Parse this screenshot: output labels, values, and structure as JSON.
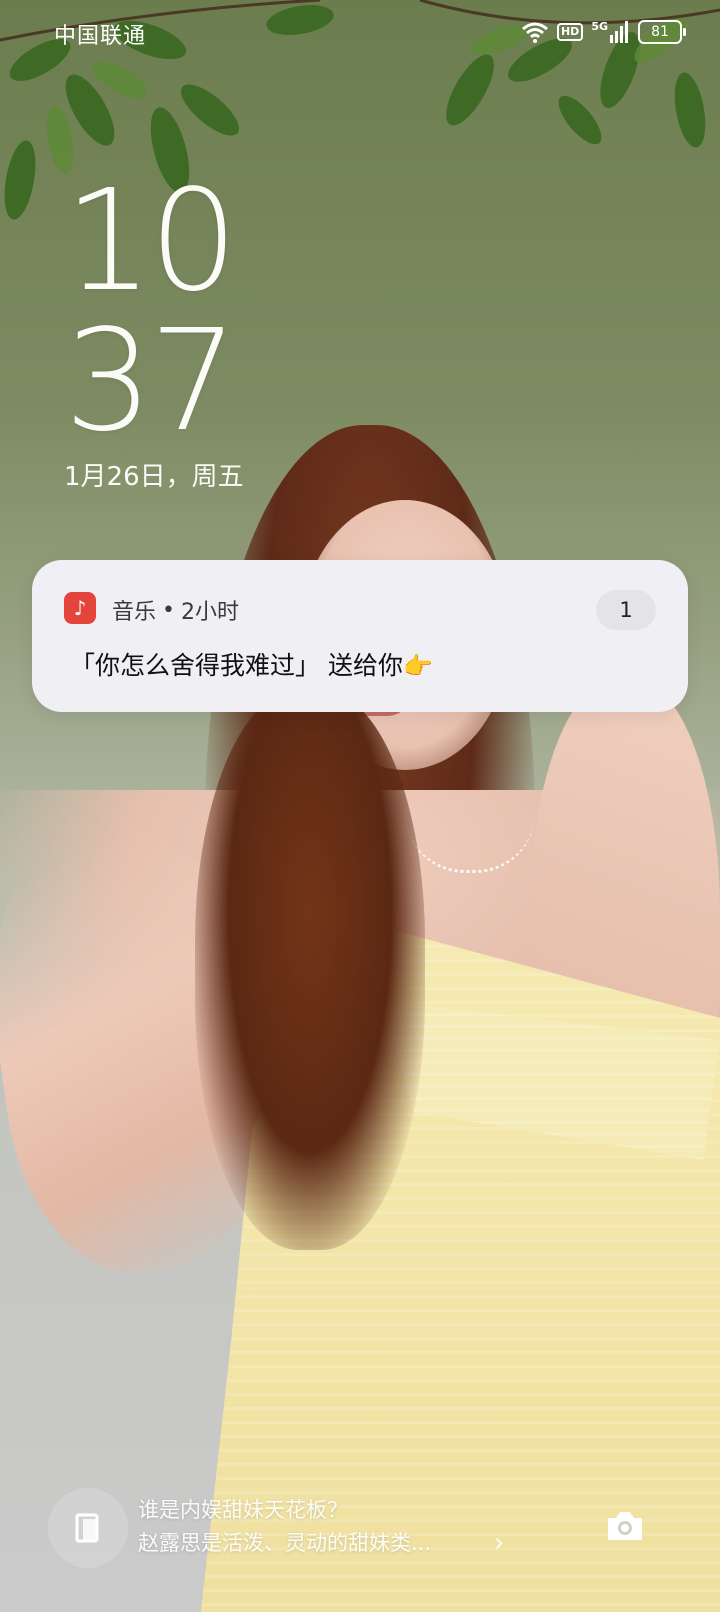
{
  "status_bar": {
    "carrier": "中国联通",
    "hd_label": "HD",
    "network_label": "5G",
    "battery": "81",
    "icons": [
      "wifi-icon",
      "hd-icon",
      "signal-5g-icon",
      "battery-icon"
    ]
  },
  "clock": {
    "hour": "10",
    "minute": "37",
    "date": "1月26日，周五"
  },
  "notification": {
    "app_name": "音乐",
    "separator": "•",
    "time_ago": "2小时",
    "count": "1",
    "message": "「你怎么舍得我难过」 送给你",
    "emoji": "👉",
    "app_icon": "music-note-icon",
    "app_icon_color": "#e4443b"
  },
  "bottom_bar": {
    "headline_line1": "谁是内娱甜妹天花板？",
    "headline_line2": "赵露思是活泼、灵动的甜妹类...",
    "chevron": "›",
    "left_icon": "magazine-icon",
    "right_icon": "camera-icon"
  }
}
